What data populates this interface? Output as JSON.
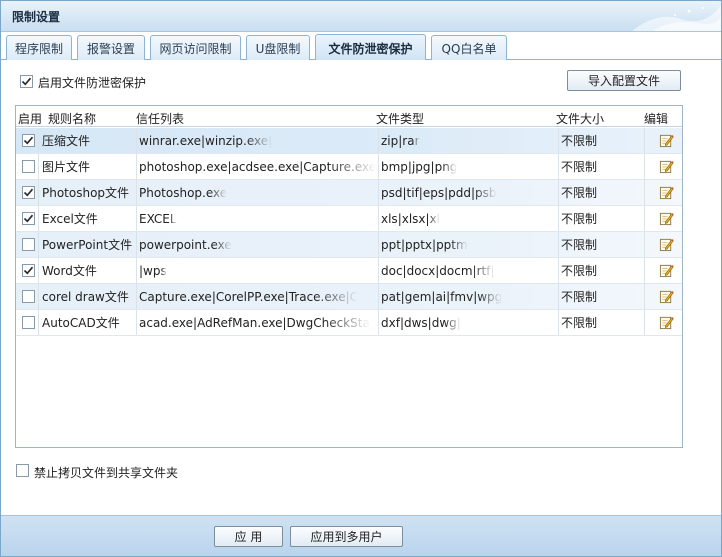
{
  "window": {
    "title": "限制设置"
  },
  "tabs": [
    {
      "label": "程序限制",
      "active": false
    },
    {
      "label": "报警设置",
      "active": false
    },
    {
      "label": "网页访问限制",
      "active": false
    },
    {
      "label": "U盘限制",
      "active": false
    },
    {
      "label": "文件防泄密保护",
      "active": true
    },
    {
      "label": "QQ白名单",
      "active": false
    }
  ],
  "panel": {
    "enable_protection": {
      "label": "启用文件防泄密保护",
      "checked": true
    },
    "import_button": "导入配置文件",
    "columns": {
      "enabled": "启用",
      "rule_name": "规则名称",
      "trust_list": "信任列表",
      "file_type": "文件类型",
      "file_size": "文件大小",
      "edit": "编辑"
    },
    "rows": [
      {
        "enabled": true,
        "name": "压缩文件",
        "trust": "winrar.exe|winzip.exe|",
        "types": "zip|rar",
        "size": "不限制"
      },
      {
        "enabled": false,
        "name": "图片文件",
        "trust": "photoshop.exe|acdsee.exe|Capture.exe",
        "types": "bmp|jpg|png",
        "size": "不限制"
      },
      {
        "enabled": true,
        "name": "Photoshop文件",
        "trust": "Photoshop.exe",
        "types": "psd|tif|eps|pdd|psb",
        "size": "不限制"
      },
      {
        "enabled": true,
        "name": "Excel文件",
        "trust": "EXCEL",
        "types": "xls|xlsx|xl",
        "size": "不限制"
      },
      {
        "enabled": false,
        "name": "PowerPoint文件",
        "trust": "powerpoint.exe",
        "types": "ppt|pptx|pptm",
        "size": "不限制"
      },
      {
        "enabled": true,
        "name": "Word文件",
        "trust": "|wps",
        "types": "doc|docx|docm|rtf|",
        "size": "不限制"
      },
      {
        "enabled": false,
        "name": "corel draw文件",
        "trust": "Capture.exe|CorelPP.exe|Trace.exe|C",
        "types": "pat|gem|ai|fmv|wpg",
        "size": "不限制"
      },
      {
        "enabled": false,
        "name": "AutoCAD文件",
        "trust": "acad.exe|AdRefMan.exe|DwgCheckSta",
        "types": "dxf|dws|dwg|",
        "size": "不限制"
      }
    ],
    "block_share_copy": {
      "label": "禁止拷贝文件到共享文件夹",
      "checked": false
    }
  },
  "footer": {
    "apply": "应 用",
    "apply_multi": "应用到多用户"
  },
  "icons": {
    "check": "check-icon",
    "edit": "pencil-note-icon"
  },
  "colors": {
    "selected_row": "#d6e7f6",
    "alt_row": "#e6f0f9",
    "footer": "#c5dcf0",
    "tab_border": "#8cb4d6"
  }
}
